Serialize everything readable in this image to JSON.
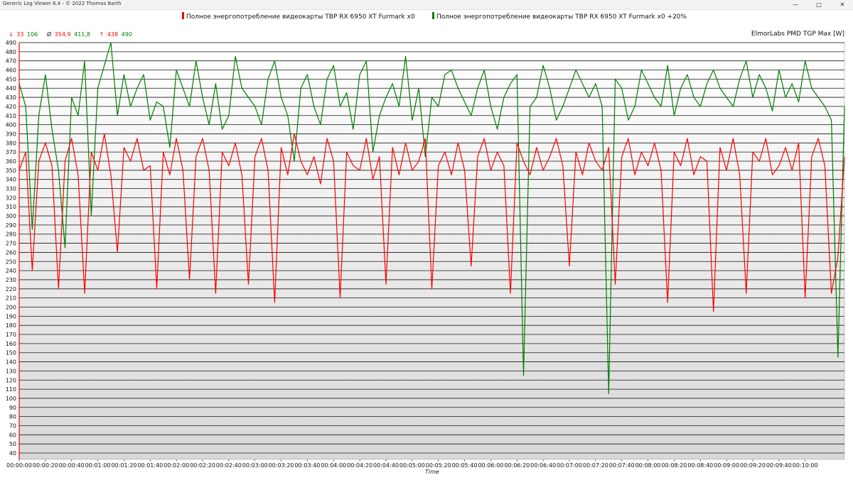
{
  "window": {
    "title": "Generic Log Viewer 6.4 - © 2022 Thomas Barth",
    "minimize_icon": "minimize-icon",
    "maximize_icon": "maximize-icon",
    "close_icon": "close-icon"
  },
  "legend": [
    {
      "label": "Полное энергопотребление видеокарты TBP RX 6950 XT Furmark x0",
      "color": "#ff0000"
    },
    {
      "label": "Полное энергопотребление видеокарты TBP RX 6950 XT Furmark x0 +20%",
      "color": "#008000"
    }
  ],
  "stats": {
    "min_symbol": "↓",
    "min_red": "33",
    "min_green": "106",
    "avg_symbol": "Ø",
    "avg_red": "354,9",
    "avg_green": "411,8",
    "max_symbol": "↑",
    "max_red": "438",
    "max_green": "490"
  },
  "sensor_label": "ElmorLabs PMD TGP Max [W]",
  "chart_data": {
    "type": "line",
    "title": "",
    "xlabel": "Time",
    "ylabel": "ElmorLabs PMD TGP Max [W]",
    "ylim": [
      33,
      490
    ],
    "xlim_seconds": [
      0,
      630
    ],
    "y_ticks": [
      40,
      50,
      60,
      70,
      80,
      90,
      100,
      110,
      120,
      130,
      140,
      150,
      160,
      170,
      180,
      190,
      200,
      210,
      220,
      230,
      240,
      250,
      260,
      270,
      280,
      290,
      300,
      310,
      320,
      330,
      340,
      350,
      360,
      370,
      380,
      390,
      400,
      410,
      420,
      430,
      440,
      450,
      460,
      470,
      480,
      490
    ],
    "x_tick_labels": [
      "00:00:00",
      "00:00:20",
      "00:00:40",
      "00:01:00",
      "00:01:20",
      "00:01:40",
      "00:02:00",
      "00:02:20",
      "00:02:40",
      "00:03:00",
      "00:03:20",
      "00:03:40",
      "00:04:00",
      "00:04:20",
      "00:04:40",
      "00:05:00",
      "00:05:20",
      "00:05:40",
      "00:06:00",
      "00:06:20",
      "00:06:40",
      "00:07:00",
      "00:07:20",
      "00:07:40",
      "00:08:00",
      "00:08:20",
      "00:08:40",
      "00:09:00",
      "00:09:20",
      "00:09:40",
      "00:10:00"
    ],
    "grid": true,
    "series": [
      {
        "name": "Полное энергопотребление видеокарты TBP RX 6950 XT Furmark x0 +20%",
        "color": "#008000",
        "stats": {
          "min": 106,
          "avg": 411.8,
          "max": 490
        },
        "x": [
          0,
          5,
          10,
          15,
          20,
          25,
          30,
          35,
          40,
          45,
          50,
          55,
          60,
          65,
          70,
          75,
          80,
          85,
          90,
          95,
          100,
          105,
          110,
          115,
          120,
          125,
          130,
          135,
          140,
          145,
          150,
          155,
          160,
          165,
          170,
          175,
          180,
          185,
          190,
          195,
          200,
          205,
          210,
          215,
          220,
          225,
          230,
          235,
          240,
          245,
          250,
          255,
          260,
          265,
          270,
          275,
          280,
          285,
          290,
          295,
          300,
          305,
          310,
          315,
          320,
          325,
          330,
          335,
          340,
          345,
          350,
          355,
          360,
          365,
          370,
          375,
          380,
          385,
          390,
          395,
          400,
          405,
          410,
          415,
          420,
          425,
          430,
          435,
          440,
          445,
          450,
          455,
          460,
          465,
          470,
          475,
          480,
          485,
          490,
          495,
          500,
          505,
          510,
          515,
          520,
          525,
          530,
          535,
          540,
          545,
          550,
          555,
          560,
          565,
          570,
          575,
          580,
          585,
          590,
          595,
          600,
          605,
          610,
          615,
          620,
          625,
          630
        ],
        "values": [
          445,
          420,
          285,
          410,
          455,
          395,
          350,
          265,
          430,
          410,
          470,
          300,
          440,
          465,
          490,
          410,
          455,
          420,
          440,
          455,
          405,
          425,
          420,
          375,
          460,
          440,
          420,
          470,
          430,
          400,
          445,
          395,
          410,
          475,
          440,
          430,
          420,
          400,
          450,
          470,
          430,
          410,
          360,
          440,
          455,
          420,
          400,
          450,
          465,
          420,
          435,
          395,
          455,
          470,
          370,
          410,
          430,
          445,
          420,
          475,
          405,
          440,
          365,
          430,
          420,
          455,
          460,
          440,
          425,
          410,
          440,
          460,
          420,
          395,
          430,
          445,
          455,
          125,
          420,
          430,
          465,
          440,
          405,
          420,
          440,
          460,
          445,
          430,
          445,
          420,
          105,
          450,
          440,
          405,
          420,
          460,
          445,
          430,
          420,
          465,
          410,
          440,
          455,
          430,
          420,
          445,
          460,
          440,
          430,
          420,
          450,
          470,
          430,
          455,
          440,
          415,
          460,
          430,
          445,
          425,
          470,
          440,
          430,
          420,
          405,
          145,
          420
        ]
      },
      {
        "name": "Полное энергопотребление видеокарты TBP RX 6950 XT Furmark x0",
        "color": "#ff0000",
        "stats": {
          "min": 33,
          "avg": 354.9,
          "max": 438
        },
        "x": [
          0,
          5,
          10,
          15,
          20,
          25,
          30,
          35,
          40,
          45,
          50,
          55,
          60,
          65,
          70,
          75,
          80,
          85,
          90,
          95,
          100,
          105,
          110,
          115,
          120,
          125,
          130,
          135,
          140,
          145,
          150,
          155,
          160,
          165,
          170,
          175,
          180,
          185,
          190,
          195,
          200,
          205,
          210,
          215,
          220,
          225,
          230,
          235,
          240,
          245,
          250,
          255,
          260,
          265,
          270,
          275,
          280,
          285,
          290,
          295,
          300,
          305,
          310,
          315,
          320,
          325,
          330,
          335,
          340,
          345,
          350,
          355,
          360,
          365,
          370,
          375,
          380,
          385,
          390,
          395,
          400,
          405,
          410,
          415,
          420,
          425,
          430,
          435,
          440,
          445,
          450,
          455,
          460,
          465,
          470,
          475,
          480,
          485,
          490,
          495,
          500,
          505,
          510,
          515,
          520,
          525,
          530,
          535,
          540,
          545,
          550,
          555,
          560,
          565,
          570,
          575,
          580,
          585,
          590,
          595,
          600,
          605,
          610,
          615,
          620,
          625,
          630
        ],
        "values": [
          350,
          370,
          240,
          360,
          380,
          355,
          220,
          360,
          385,
          345,
          215,
          370,
          350,
          390,
          345,
          260,
          375,
          360,
          385,
          350,
          355,
          220,
          370,
          345,
          385,
          350,
          230,
          365,
          385,
          350,
          215,
          370,
          355,
          380,
          345,
          225,
          365,
          385,
          350,
          205,
          375,
          345,
          390,
          360,
          345,
          365,
          335,
          385,
          360,
          210,
          370,
          355,
          350,
          385,
          340,
          365,
          225,
          375,
          345,
          380,
          350,
          360,
          385,
          220,
          355,
          370,
          345,
          380,
          350,
          245,
          365,
          385,
          350,
          370,
          355,
          215,
          380,
          360,
          345,
          375,
          350,
          365,
          385,
          355,
          245,
          370,
          345,
          380,
          360,
          350,
          375,
          225,
          365,
          385,
          345,
          370,
          355,
          380,
          350,
          205,
          370,
          355,
          385,
          345,
          365,
          360,
          195,
          375,
          350,
          385,
          345,
          215,
          370,
          360,
          385,
          345,
          355,
          375,
          350,
          380,
          210,
          365,
          385,
          355,
          215,
          255,
          365
        ]
      }
    ]
  }
}
